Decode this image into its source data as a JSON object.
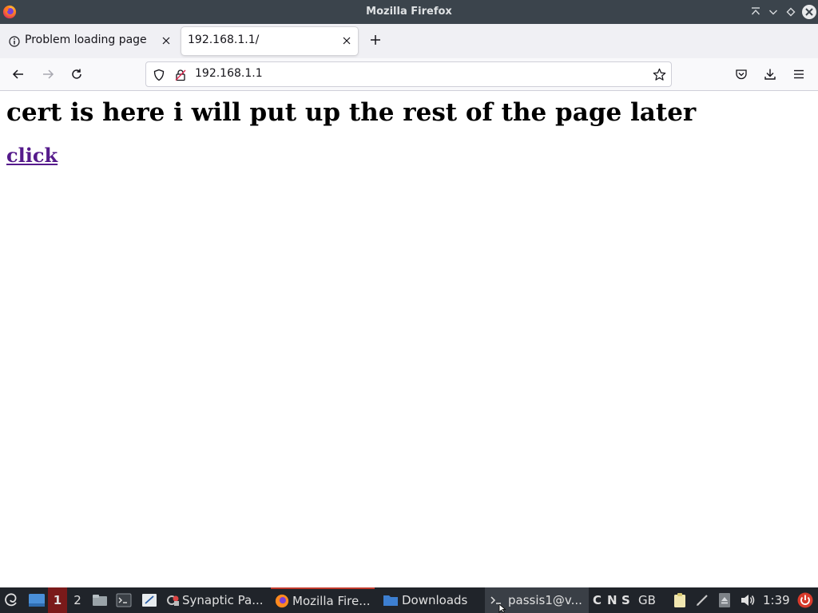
{
  "window": {
    "title": "Mozilla Firefox"
  },
  "tabs": [
    {
      "label": "Problem loading page",
      "active": false
    },
    {
      "label": "192.168.1.1/",
      "active": true
    }
  ],
  "urlbar": {
    "value": "192.168.1.1"
  },
  "page": {
    "heading": "cert is here i will put up the rest of the page later",
    "link_text": "click",
    "link_color": "#551a8b"
  },
  "taskbar": {
    "workspaces": [
      "1",
      "2"
    ],
    "active_workspace": "1",
    "apps": [
      {
        "label": "Synaptic Pa...",
        "icon": "synaptic-icon"
      },
      {
        "label": "Mozilla Fire...",
        "icon": "firefox-icon"
      },
      {
        "label": "Downloads",
        "icon": "folder-icon"
      },
      {
        "label": "passis1@v...",
        "icon": "terminal-icon"
      }
    ],
    "tray_letters": [
      "C",
      "N",
      "S"
    ],
    "keyboard_layout": "GB",
    "clock": "1:39"
  },
  "colors": {
    "titlebar": "#3b444c",
    "tabstrip": "#f0f0f4",
    "taskbar": "#20242a",
    "active_workspace": "#7a1a1a",
    "active_app_indicator": "#c0392b"
  }
}
